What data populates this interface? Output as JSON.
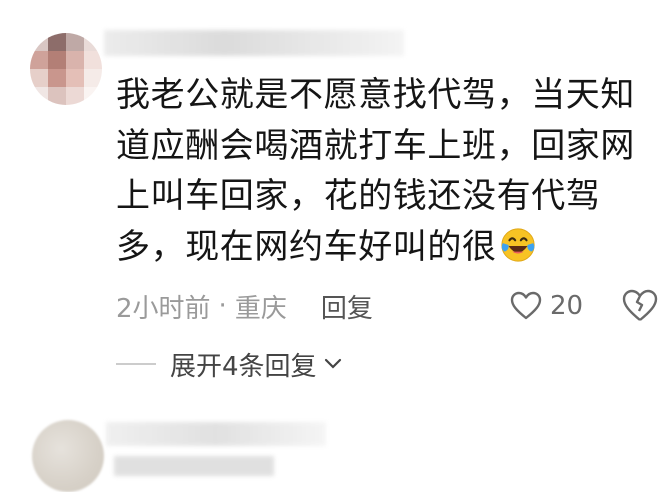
{
  "comment": {
    "text": "我老公就是不愿意找代驾，当天知道应酬会喝酒就打车上班，回家网上叫车回家，花的钱还没有代驾多，现在网约车好叫的很",
    "emoji": "laughing-crying-emoji",
    "time": "2小时前",
    "separator": "·",
    "location": "重庆",
    "reply_label": "回复",
    "like_count": "20"
  },
  "expand": {
    "label": "展开4条回复"
  },
  "colors": {
    "meta_text": "#9a9a9a",
    "emoji_yellow": "#f7c324",
    "emoji_blue": "#3ea2f0"
  }
}
